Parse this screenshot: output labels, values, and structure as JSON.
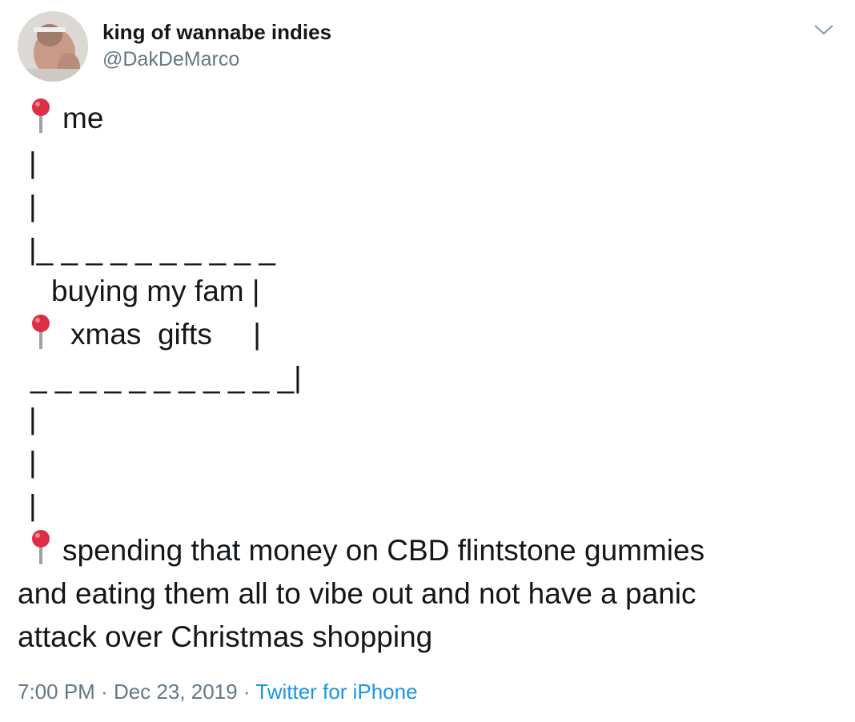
{
  "author": {
    "display_name": "king of wannabe indies",
    "handle": "@DakDeMarco"
  },
  "icons": {
    "pin": "round-pushpin-icon",
    "caret": "chevron-down-icon"
  },
  "tweet": {
    "lines": [
      "me",
      "|",
      "|",
      "|_ _ _ _ _ _ _ _ _ _",
      "buying my fam |",
      "xmas  gifts     |",
      "_ _ _ _ _ _ _ _ _ _ _|",
      "|",
      "|",
      "|",
      "spending that money on CBD flintstone gummies",
      "and eating them all to vibe out and not have a panic",
      "attack over Christmas shopping"
    ]
  },
  "meta": {
    "time": "7:00 PM",
    "separator": " · ",
    "date": "Dec 23, 2019",
    "source": "Twitter for iPhone"
  },
  "colors": {
    "text": "#14171a",
    "secondary": "#657786",
    "link": "#1b95e0",
    "pin_head": "#dd2e44"
  }
}
